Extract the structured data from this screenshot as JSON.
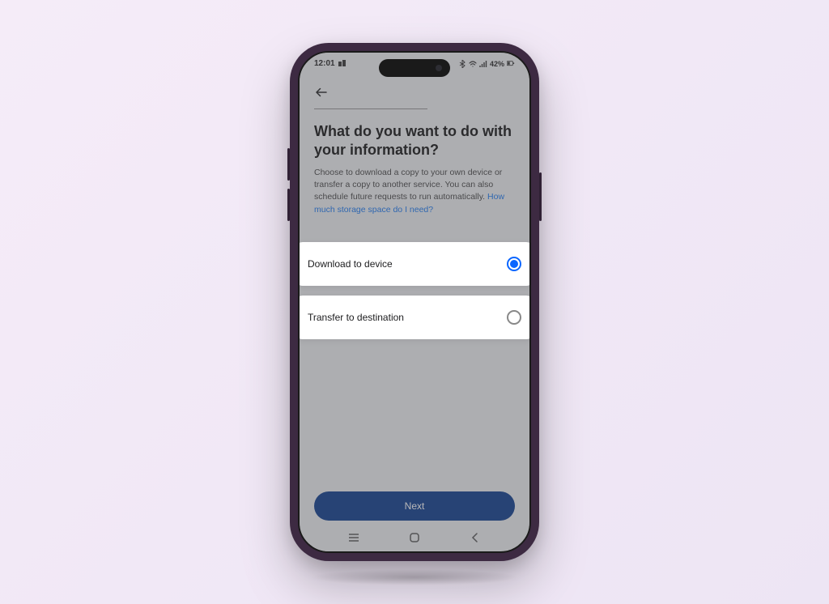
{
  "statusBar": {
    "time": "12:01",
    "battery": "42%"
  },
  "page": {
    "title": "What do you want to do with your information?",
    "description": "Choose to download a copy to your own device or transfer a copy to another service. You can also schedule future requests to run automatically. ",
    "helpLink": "How much storage space do I need?"
  },
  "options": {
    "download": {
      "label": "Download to device",
      "selected": true
    },
    "transfer": {
      "label": "Transfer to destination",
      "selected": false
    }
  },
  "footer": {
    "nextLabel": "Next"
  }
}
